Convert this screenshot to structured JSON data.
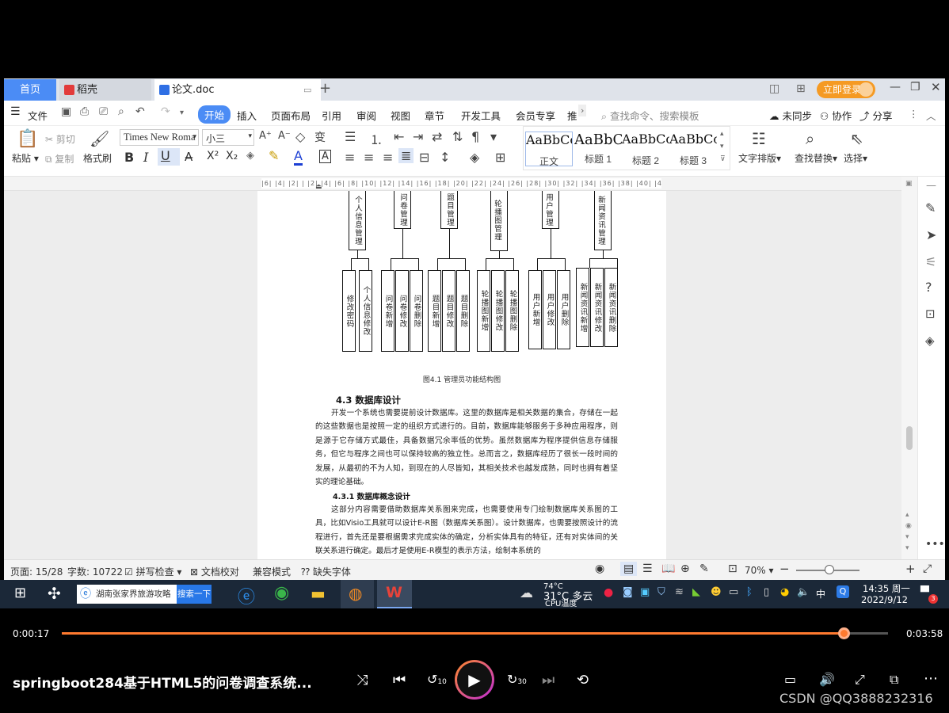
{
  "window": {
    "tabs": [
      {
        "label": "首页"
      },
      {
        "label": "稻壳"
      },
      {
        "label": "论文.doc"
      }
    ],
    "login_button": "立即登录"
  },
  "menu": {
    "file": "文件",
    "items": [
      "开始",
      "插入",
      "页面布局",
      "引用",
      "审阅",
      "视图",
      "章节",
      "开发工具",
      "会员专享",
      "推"
    ],
    "search_placeholder": "查找命令、搜索模板",
    "right": [
      "未同步",
      "协作",
      "分享"
    ]
  },
  "ribbon": {
    "paste": "粘贴",
    "cut": "剪切",
    "copy": "复制",
    "format_painter": "格式刷",
    "font_name": "Times New Roma",
    "font_size": "小三",
    "styles": [
      {
        "preview": "AaBbCcI",
        "name": "正文"
      },
      {
        "preview": "AaBbC",
        "name": "标题 1"
      },
      {
        "preview": "AaBbCc",
        "name": "标题 2"
      },
      {
        "preview": "AaBbCc",
        "name": "标题 3"
      }
    ],
    "text_layout": "文字排版",
    "find_replace": "查找替换",
    "select": "选择"
  },
  "ruler_text": "|6| |4| |2| |  |2| |4| |6| |8| |10| |12| |14| |16| |18| |20| |22| |24| |26| |28| |30| |32| |34| |36| |38| |40| |42|",
  "document": {
    "top_modules": [
      "个人信息管理",
      "问卷管理",
      "题目管理",
      "轮播图管理",
      "用户管理",
      "新闻资讯管理"
    ],
    "sub_modules": [
      [
        "修改密码",
        "个人信息修改"
      ],
      [
        "问卷新增",
        "问卷修改",
        "问卷删除"
      ],
      [
        "题目新增",
        "题目修改",
        "题目删除"
      ],
      [
        "轮播图新增",
        "轮播图修改",
        "轮播图删除"
      ],
      [
        "用户新增",
        "用户修改",
        "用户删除"
      ],
      [
        "新闻资讯新增",
        "新闻资讯修改",
        "新闻资讯删除"
      ]
    ],
    "caption": "图4.1 管理员功能结构图",
    "heading": "4.3  数据库设计",
    "para1": "开发一个系统也需要提前设计数据库。这里的数据库是相关数据的集合，存储在一起的这些数据也是按照一定的组织方式进行的。目前，数据库能够服务于多种应用程序，则是源于它存储方式最佳，具备数据冗余率低的优势。虽然数据库为程序提供信息存储服务，但它与程序之间也可以保持较高的独立性。总而言之，数据库经历了很长一段时间的发展，从最初的不为人知，到现在的人尽皆知，其相关技术也越发成熟，同时也拥有着坚实的理论基础。",
    "subheading": "4.3.1  数据库概念设计",
    "para2": "这部分内容需要借助数据库关系图来完成，也需要使用专门绘制数据库关系图的工具，比如Visio工具就可以设计E-R图（数据库关系图）。设计数据库，也需要按照设计的流程进行，首先还是要根据需求完成实体的确定，分析实体具有的特征，还有对实体间的关联关系进行确定。最后才是使用E-R模型的表示方法，绘制本系统的"
  },
  "status": {
    "page": "页面: 15/28",
    "words": "字数: 10722",
    "spell": "拼写检查",
    "proof": "文档校对",
    "compat": "兼容模式",
    "missing_font": "缺失字体",
    "zoom": "70%"
  },
  "taskbar": {
    "search_text": "湖南张家界旅游攻略",
    "search_button": "搜索一下",
    "weather_temp": "31°C 多云",
    "cpu_line1": "74°C",
    "cpu_line2": "CPU温度",
    "ime": "中",
    "time": "14:35 周一",
    "date": "2022/9/12",
    "notif": "3"
  },
  "player": {
    "elapsed": "0:00:17",
    "total": "0:03:58",
    "progress": 0.946,
    "title": "springboot284基于HTML5的问卷调查系统...",
    "watermark": "CSDN @QQ3888232316",
    "rewind_label": "10",
    "forward_label": "30"
  },
  "colors": {
    "accent_blue": "#4b8cf5",
    "progress_orange": "#ff7a2f",
    "login_orange": "#f59a23"
  }
}
